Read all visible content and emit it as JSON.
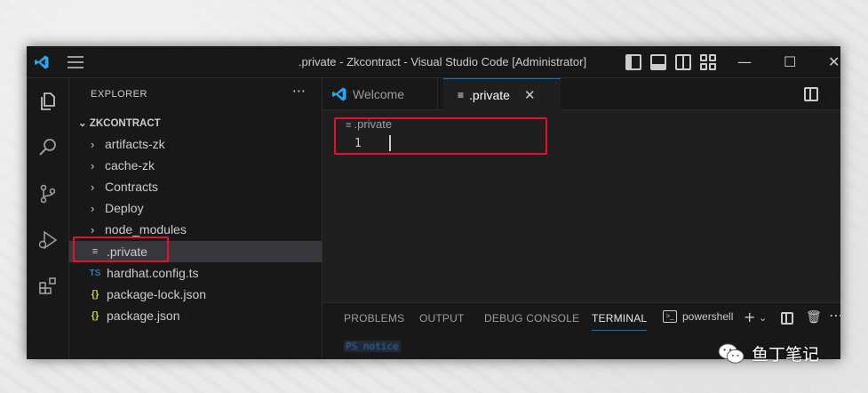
{
  "window": {
    "title": ".private - Zkcontract - Visual Studio Code [Administrator]"
  },
  "sidebar": {
    "header": "EXPLORER",
    "more_label": "···",
    "root": "ZKCONTRACT",
    "items": [
      {
        "label": "artifacts-zk",
        "kind": "folder"
      },
      {
        "label": "cache-zk",
        "kind": "folder"
      },
      {
        "label": "Contracts",
        "kind": "folder"
      },
      {
        "label": "Deploy",
        "kind": "folder"
      },
      {
        "label": "node_modules",
        "kind": "folder"
      },
      {
        "label": ".private",
        "kind": "file-text",
        "selected": true
      },
      {
        "label": "hardhat.config.ts",
        "kind": "file-ts",
        "icon_text": "TS"
      },
      {
        "label": "package-lock.json",
        "kind": "file-json",
        "icon_text": "{}"
      },
      {
        "label": "package.json",
        "kind": "file-json",
        "icon_text": "{}"
      }
    ]
  },
  "editor": {
    "tabs": [
      {
        "label": "Welcome",
        "active": false
      },
      {
        "label": ".private",
        "active": true,
        "close": "✕"
      }
    ],
    "breadcrumb": ".private",
    "line_number": "1"
  },
  "panel": {
    "tabs": [
      "PROBLEMS",
      "OUTPUT",
      "DEBUG CONSOLE",
      "TERMINAL"
    ],
    "active_tab": "TERMINAL",
    "shell": "powershell",
    "terminal_text": "PS  notice"
  },
  "watermark": {
    "text": "鱼丁笔记"
  },
  "colors": {
    "accent": "#0078d4",
    "highlight": "#e8112d",
    "vscode_blue": "#23a9f2"
  },
  "icons": [
    "vscode-logo-icon",
    "menu-icon",
    "explorer-icon",
    "search-icon",
    "source-control-icon",
    "run-debug-icon",
    "extensions-icon",
    "split-editor-icon",
    "wechat-icon"
  ]
}
